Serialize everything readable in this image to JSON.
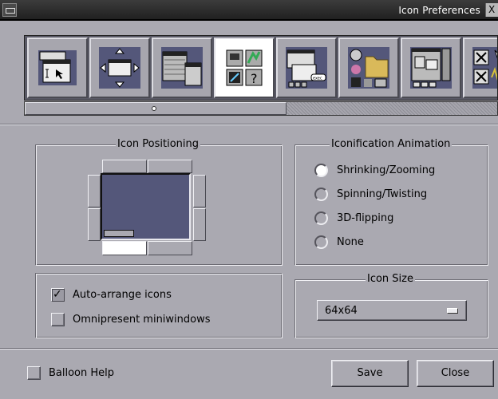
{
  "window": {
    "title": "Icon Preferences",
    "close_glyph": "X"
  },
  "strip": {
    "icons": [
      {
        "name": "window-focus-icon"
      },
      {
        "name": "window-move-icon"
      },
      {
        "name": "menu-prefs-icon"
      },
      {
        "name": "icon-prefs-icon"
      },
      {
        "name": "keyboard-shortcuts-icon"
      },
      {
        "name": "workspace-icons-icon"
      },
      {
        "name": "workspace-prefs-icon"
      },
      {
        "name": "misc-prefs-icon"
      }
    ]
  },
  "icon_positioning": {
    "title": "Icon Positioning",
    "selected": "bottom-left"
  },
  "iconification": {
    "title": "Iconification Animation",
    "options": [
      "Shrinking/Zooming",
      "Spinning/Twisting",
      "3D-flipping",
      "None"
    ],
    "selected_index": 0
  },
  "options": {
    "auto_arrange_label": "Auto-arrange icons",
    "auto_arrange_checked": true,
    "omnipresent_label": "Omnipresent miniwindows",
    "omnipresent_checked": false,
    "check_glyph": "✓"
  },
  "icon_size": {
    "title": "Icon Size",
    "value": "64x64"
  },
  "footer": {
    "balloon_help_label": "Balloon Help",
    "save_label": "Save",
    "close_label": "Close"
  },
  "colors": {
    "background": "#aaa9b1",
    "screen": "#54577a",
    "titlebar": "#2a2a2a"
  }
}
